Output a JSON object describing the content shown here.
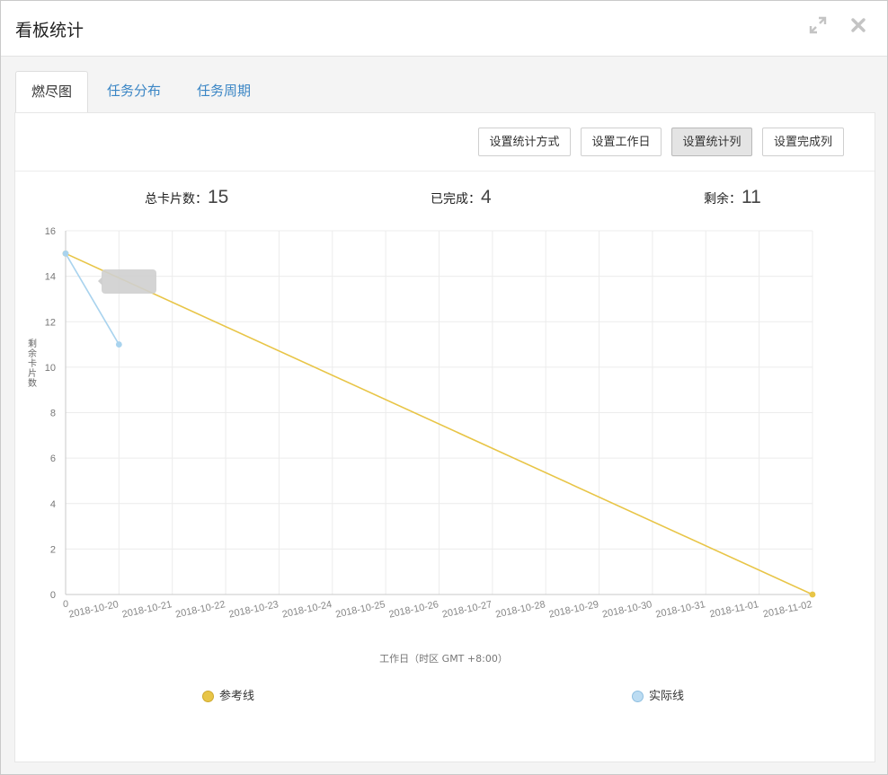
{
  "window": {
    "title": "看板统计"
  },
  "icons": {
    "expand": "expand-icon",
    "close": "close-icon"
  },
  "tabs": [
    {
      "label": "燃尽图",
      "active": true
    },
    {
      "label": "任务分布",
      "active": false
    },
    {
      "label": "任务周期",
      "active": false
    }
  ],
  "toolbar": {
    "buttons": [
      {
        "label": "设置统计方式"
      },
      {
        "label": "设置工作日"
      },
      {
        "label": "设置统计列",
        "pressed": true
      },
      {
        "label": "设置完成列"
      }
    ]
  },
  "stats": {
    "total_label": "总卡片数：",
    "total_value": "15",
    "done_label": "已完成：",
    "done_value": "4",
    "remaining_label": "剩余：",
    "remaining_value": "11"
  },
  "colors": {
    "reference": "#e8c547",
    "actual": "#a9d3ee",
    "tab_link": "#3b86c5"
  },
  "chart_data": {
    "type": "line",
    "xlabel": "工作日（时区 GMT +8:00）",
    "ylabel": "剩余卡片数",
    "ylim": [
      0,
      16
    ],
    "yticks": [
      "0",
      "2",
      "4",
      "6",
      "8",
      "10",
      "12",
      "14",
      "16"
    ],
    "categories": [
      "0",
      "2018-10-20",
      "2018-10-21",
      "2018-10-22",
      "2018-10-23",
      "2018-10-24",
      "2018-10-25",
      "2018-10-26",
      "2018-10-27",
      "2018-10-28",
      "2018-10-29",
      "2018-10-30",
      "2018-10-31",
      "2018-11-01",
      "2018-11-02"
    ],
    "series": [
      {
        "name": "参考线",
        "color": "#e8c547",
        "x": [
          "0",
          "2018-11-02"
        ],
        "values": [
          15,
          0
        ]
      },
      {
        "name": "实际线",
        "color": "#a9d3ee",
        "x": [
          "0",
          "2018-10-20"
        ],
        "values": [
          15,
          11
        ]
      }
    ],
    "grid": true,
    "legend": "bottom"
  }
}
